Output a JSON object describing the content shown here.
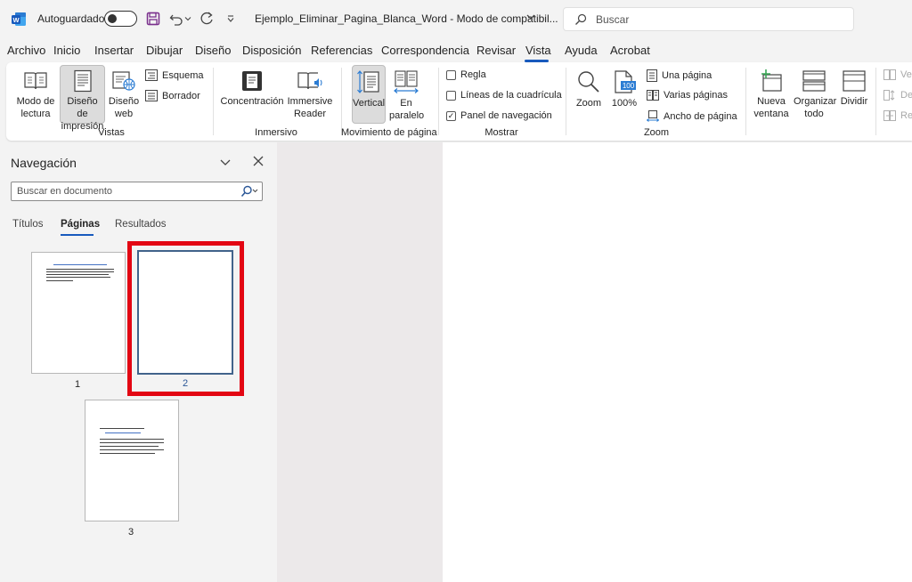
{
  "titlebar": {
    "autosave_label": "Autoguardado",
    "document_title": "Ejemplo_Eliminar_Pagina_Blanca_Word  -  Modo de compatibil...",
    "search_placeholder": "Buscar"
  },
  "menu": {
    "tabs": [
      "Archivo",
      "Inicio",
      "Insertar",
      "Dibujar",
      "Diseño",
      "Disposición",
      "Referencias",
      "Correspondencia",
      "Revisar",
      "Vista",
      "Ayuda",
      "Acrobat"
    ],
    "active_tab": "Vista"
  },
  "ribbon": {
    "vistas": {
      "label": "Vistas",
      "modo_lectura": [
        "Modo de",
        "lectura"
      ],
      "diseno_impresion": [
        "Diseño de",
        "impresión"
      ],
      "diseno_web": [
        "Diseño",
        "web"
      ],
      "esquema": "Esquema",
      "borrador": "Borrador"
    },
    "inmersivo": {
      "label": "Inmersivo",
      "concentracion": "Concentración",
      "immersive_reader": [
        "Immersive",
        "Reader"
      ]
    },
    "movimiento": {
      "label": "Movimiento de página",
      "vertical": "Vertical",
      "en_paralelo": [
        "En",
        "paralelo"
      ]
    },
    "mostrar": {
      "label": "Mostrar",
      "regla": "Regla",
      "lineas_cuadricula": "Líneas de la cuadrícula",
      "panel_navegacion": "Panel de navegación"
    },
    "zoom": {
      "label": "Zoom",
      "zoom": "Zoom",
      "cien": "100%",
      "cien_icon_text": "100",
      "una_pagina": "Una página",
      "varias_paginas": "Varias páginas",
      "ancho_pagina": "Ancho de página"
    },
    "ventana": {
      "nueva_ventana": [
        "Nueva",
        "ventana"
      ],
      "organizar_todo": [
        "Organizar",
        "todo"
      ],
      "dividir": "Dividir",
      "clipped_1": "Ver",
      "clipped_2": "De",
      "clipped_3": "Re"
    }
  },
  "nav": {
    "title": "Navegación",
    "search_placeholder": "Buscar en documento",
    "tabs": [
      "Títulos",
      "Páginas",
      "Resultados"
    ],
    "pages": [
      "1",
      "2",
      "3"
    ]
  },
  "colors": {
    "accent": "#185abd",
    "highlight": "#e30613",
    "selected_border": "#41638b"
  }
}
